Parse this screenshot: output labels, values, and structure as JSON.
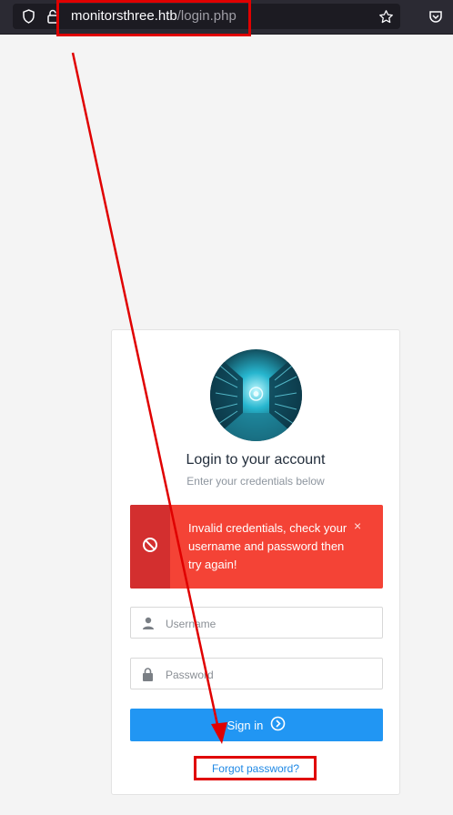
{
  "browser": {
    "url_host": "monitorsthree.htb",
    "url_path": "/login.php"
  },
  "login": {
    "title": "Login to your account",
    "subtitle": "Enter your credentials below",
    "alert_message": "Invalid credentials, check your username and password then try again!",
    "alert_close": "×",
    "username_placeholder": "Username",
    "password_placeholder": "Password",
    "signin_label": "Sign in",
    "forgot_label": "Forgot password?"
  },
  "icons": {
    "shield": "shield-icon",
    "lock": "lock-icon",
    "star": "star-icon",
    "pocket": "pocket-icon",
    "ban": "ban-icon",
    "user": "user-icon",
    "padlock": "padlock-icon",
    "arrow_right": "arrow-circle-right-icon"
  },
  "colors": {
    "alert_bg": "#f44336",
    "alert_icon_bg": "#d32f2f",
    "primary": "#2196f3",
    "annotation": "#e00000"
  }
}
